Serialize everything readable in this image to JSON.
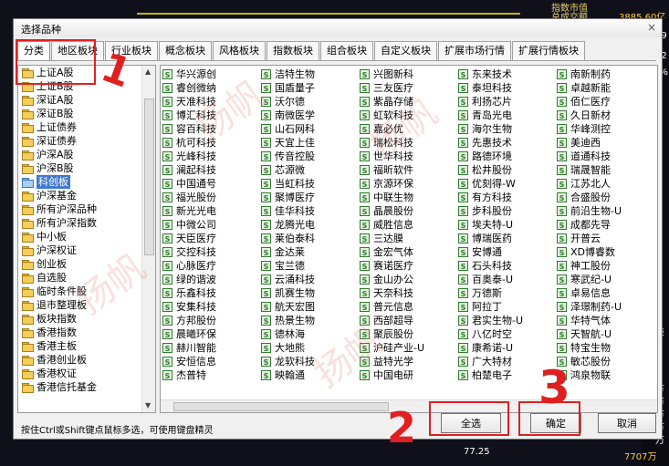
{
  "background": {
    "top_labels": [
      "指数市值",
      "总成交额"
    ],
    "top_value": "3885.60亿",
    "right_edge": [
      "09",
      "52",
      "7%",
      "别表",
      "万",
      "万",
      "万",
      "万",
      "万"
    ],
    "bottom_value": "77.25",
    "bottom_right_value": "7707万"
  },
  "dialog": {
    "title": "选择品种",
    "close_label": "×",
    "tabs": [
      "分类",
      "地区板块",
      "行业板块",
      "概念板块",
      "风格板块",
      "指数板块",
      "组合板块",
      "自定义板块",
      "扩展市场行情",
      "扩展行情板块"
    ],
    "left_items": [
      {
        "label": "上证A股",
        "selected": false
      },
      {
        "label": "上证B股",
        "selected": false
      },
      {
        "label": "深证A股",
        "selected": false
      },
      {
        "label": "深证B股",
        "selected": false
      },
      {
        "label": "上证债券",
        "selected": false
      },
      {
        "label": "深证债券",
        "selected": false
      },
      {
        "label": "沪深A股",
        "selected": false
      },
      {
        "label": "沪深B股",
        "selected": false
      },
      {
        "label": "科创板",
        "selected": true
      },
      {
        "label": "沪深基金",
        "selected": false
      },
      {
        "label": "所有沪深品种",
        "selected": false
      },
      {
        "label": "所有沪深指数",
        "selected": false
      },
      {
        "label": "中小板",
        "selected": false
      },
      {
        "label": "沪深权证",
        "selected": false
      },
      {
        "label": "创业板",
        "selected": false
      },
      {
        "label": "自选股",
        "selected": false
      },
      {
        "label": "临时条件股",
        "selected": false
      },
      {
        "label": "退市整理板",
        "selected": false
      },
      {
        "label": "板块指数",
        "selected": false
      },
      {
        "label": "香港指数",
        "selected": false
      },
      {
        "label": "香港主板",
        "selected": false
      },
      {
        "label": "香港创业板",
        "selected": false
      },
      {
        "label": "香港权证",
        "selected": false
      },
      {
        "label": "香港信托基金",
        "selected": false
      }
    ],
    "stock_columns": [
      [
        "华兴源创",
        "睿创微纳",
        "天准科技",
        "博汇科技",
        "容百科技",
        "杭可科技",
        "光峰科技",
        "澜起科技",
        "中国通号",
        "福光股份",
        "新光光电",
        "中微公司",
        "天臣医疗",
        "交控科技",
        "心脉医疗",
        "绿的谐波",
        "乐鑫科技",
        "安集科技",
        "方邦股份",
        "晨曦环保",
        "赫川智能",
        "安恒信息",
        "杰普特"
      ],
      [
        "洁特生物",
        "国盾量子",
        "沃尔德",
        "南微医学",
        "山石网科",
        "天宜上佳",
        "传音控股",
        "芯源微",
        "当虹科技",
        "聚博医疗",
        "佳华科技",
        "龙腾光电",
        "莱伯泰科",
        "金达莱",
        "宝兰德",
        "云涌科技",
        "凯赛生物",
        "航天宏图",
        "热景生物",
        "德林海",
        "大地熊",
        "龙软科技",
        "映翰通"
      ],
      [
        "兴图新科",
        "三友医疗",
        "紫晶存储",
        "虹软科技",
        "嘉必优",
        "瑞松科技",
        "世华科技",
        "福昕软件",
        "京源环保",
        "中联生物",
        "晶晨股份",
        "威胜信息",
        "三达膜",
        "金宏气体",
        "赛诺医疗",
        "金山办公",
        "天奈科技",
        "普元信息",
        "西部超导",
        "聚辰股份",
        "沪硅产业-U",
        "益特光学",
        "中国电研"
      ],
      [
        "东来技术",
        "泰坦科技",
        "利扬芯片",
        "青岛光电",
        "海尔生物",
        "先惠技术",
        "路德环境",
        "松井股份",
        "优刻得-W",
        "有方科技",
        "步科股份",
        "埃夫特-U",
        "博瑞医药",
        "安博通",
        "石头科技",
        "百奥泰-U",
        "万德斯",
        "阿拉丁",
        "君实生物-U",
        "八亿时空",
        "康希诺-U",
        "广大特材",
        "柏楚电子"
      ],
      [
        "南新制药",
        "卓越新能",
        "佰仁医疗",
        "久日新材",
        "华峰测控",
        "美迪西",
        "道通科技",
        "瑞晟智能",
        "江苏北人",
        "合盛股份",
        "前沿生物-U",
        "成都先导",
        "开普云",
        "XD博睿数",
        "神工股份",
        "寒武纪-U",
        "卓易信息",
        "泽璟制药-U",
        "华特气体",
        "天智航-U",
        "特宝生物",
        "敏芯股份",
        "鸿泉物联"
      ]
    ],
    "status_text": "按住Ctrl或Shift键点鼠标多选，可使用键盘精灵",
    "buttons": {
      "select_all": "全选",
      "ok": "确定",
      "cancel": "取消"
    }
  },
  "annotations": {
    "step1": "1",
    "step2": "2",
    "step3": "3"
  },
  "watermark": [
    "扬帆",
    "扬帆",
    "扬帆",
    "扬帆"
  ],
  "colors": {
    "annotation": "#e02020",
    "selection": "#3f78d0",
    "stock_icon": "#2f7d2f"
  }
}
